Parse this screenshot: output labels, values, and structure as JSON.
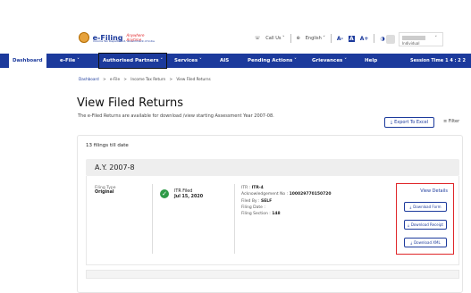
{
  "header": {
    "logo_text": "e-Filing",
    "logo_tagline": "Anywhere Anytime",
    "logo_sub": "Income Tax Department, Government of India",
    "call_us": "Call Us",
    "language": "English",
    "font_smaller": "A-",
    "font_normal": "A",
    "font_larger": "A+",
    "contrast": "◑",
    "user_role": "Individual"
  },
  "nav": {
    "items": [
      {
        "label": "Dashboard"
      },
      {
        "label": "e-File ˅"
      },
      {
        "label": "Authorised Partners ˅"
      },
      {
        "label": "Services ˅"
      },
      {
        "label": "AIS"
      },
      {
        "label": "Pending Actions ˅"
      },
      {
        "label": "Grievances ˅"
      },
      {
        "label": "Help"
      }
    ],
    "session_label": "Session Time",
    "session_value": "1 4 : 2 2"
  },
  "breadcrumb": [
    "Dashboard",
    ">",
    "e-File",
    ">",
    "Income Tax Return",
    ">",
    "View Filed Returns"
  ],
  "page": {
    "title": "View Filed Returns",
    "subtitle": "The e-Filed Returns are available for download /view starting Assessment Year 2007-08.",
    "export_label": "Export To Excel",
    "filter_label": "Filter"
  },
  "filings": {
    "count_text": "13 filings till date",
    "items": [
      {
        "ay": "A.Y. 2007-8",
        "filing_type_label": "Filing Type",
        "filing_type_value": "Original",
        "status": "ITR Filed",
        "status_date": "Jul 15, 2020",
        "itr_label": "ITR :",
        "itr_value": "ITR-4",
        "ack_label": "Acknowledgement No :",
        "ack_value": "100029770150720",
        "filed_by_label": "Filed By :",
        "filed_by_value": "SELF",
        "filing_date_label": "Filing Date :",
        "filing_date_value": "",
        "filing_section_label": "Filing Section :",
        "filing_section_value": "148",
        "view_details": "View Details",
        "download_form": "Download Form",
        "download_receipt": "Download Receipt",
        "download_xml": "Download XML"
      }
    ]
  },
  "colors": {
    "brand": "#1c3a9c",
    "highlight": "#e0272a",
    "success": "#2e9a47"
  }
}
